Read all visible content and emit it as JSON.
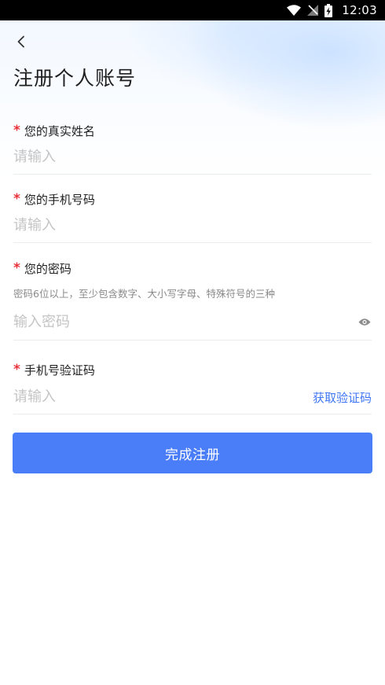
{
  "status_bar": {
    "time": "12:03",
    "icons": [
      "wifi-icon",
      "signal-off-icon",
      "battery-charging-icon"
    ]
  },
  "header": {
    "back_icon": "chevron-left-icon",
    "title": "注册个人账号"
  },
  "form": {
    "required_mark": "*",
    "name": {
      "label": "您的真实姓名",
      "placeholder": "请输入"
    },
    "phone": {
      "label": "您的手机号码",
      "placeholder": "请输入"
    },
    "password": {
      "label": "您的密码",
      "hint": "密码6位以上，至少包含数字、大小写字母、特殊符号的三种",
      "placeholder": "输入密码",
      "toggle_icon": "eye-icon"
    },
    "sms_code": {
      "label": "手机号验证码",
      "placeholder": "请输入",
      "get_code_label": "获取验证码"
    },
    "submit_label": "完成注册"
  },
  "colors": {
    "primary": "#4a7df8",
    "link": "#3f76f5",
    "required": "#e8313a",
    "placeholder": "#c4c4c4"
  }
}
